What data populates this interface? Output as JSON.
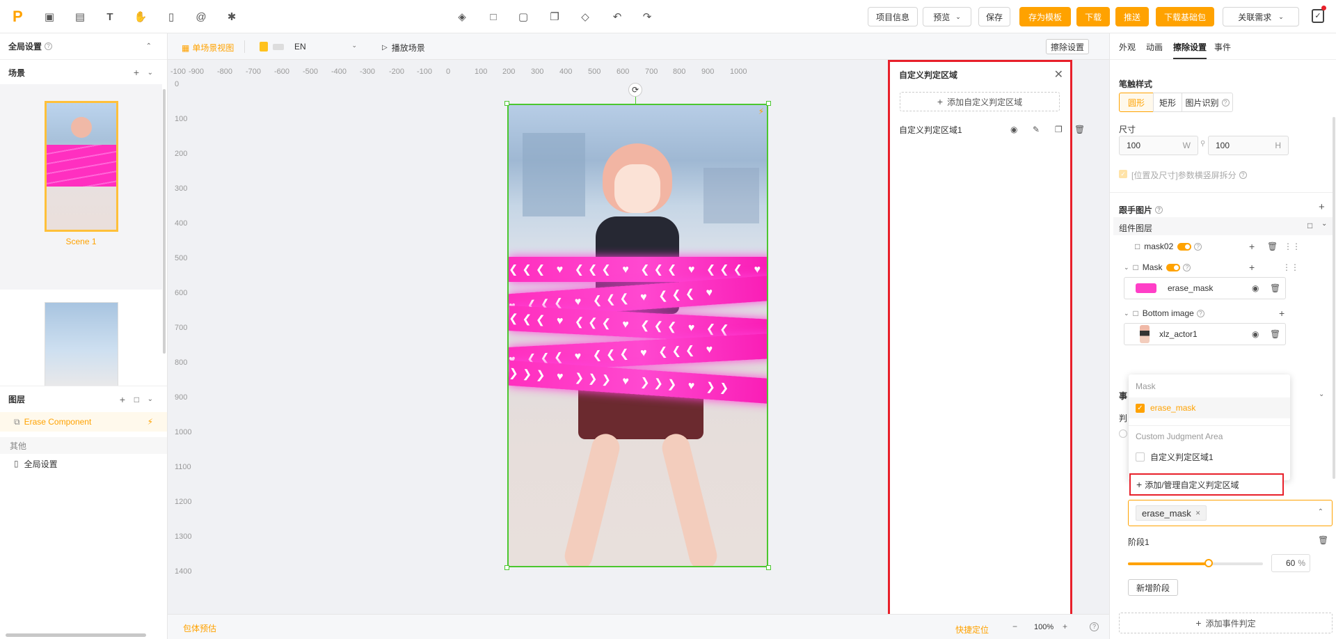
{
  "topbar": {
    "buttons": {
      "project_info": "项目信息",
      "preview": "预览",
      "save": "保存",
      "save_template": "存为模板",
      "download": "下载",
      "push": "推送",
      "download_base": "下载基础包",
      "link_requirement": "关联需求"
    }
  },
  "left": {
    "global_settings": "全局设置",
    "scene_header": "场景",
    "scene1_label": "Scene 1",
    "layers_header": "图层",
    "erase_component": "Erase Component",
    "other": "其他",
    "global_settings_item": "全局设置"
  },
  "canvas": {
    "tab_single_view": "单场景视图",
    "lang": "EN",
    "play_scene": "播放场景",
    "erase_settings_btn": "擦除设置",
    "footer_left": "包体预估",
    "quick_locate": "快捷定位",
    "zoom": "100%",
    "ruler_top": [
      "-100",
      "-900",
      "-800",
      "-700",
      "-600",
      "-500",
      "-400",
      "-300",
      "-200",
      "-100",
      "0",
      "100",
      "200",
      "300",
      "400",
      "500",
      "600",
      "700",
      "800",
      "900",
      "1000"
    ],
    "ruler_left": [
      "0",
      "100",
      "200",
      "300",
      "400",
      "500",
      "600",
      "700",
      "800",
      "900",
      "1000",
      "1100",
      "1200",
      "1300",
      "1400"
    ]
  },
  "custom_panel": {
    "title": "自定义判定区域",
    "add_btn": "添加自定义判定区域",
    "items": [
      "自定义判定区域1"
    ]
  },
  "right": {
    "tabs": [
      "外观",
      "动画",
      "擦除设置",
      "事件"
    ],
    "brush_style": "笔触样式",
    "brush_options": [
      "圆形",
      "矩形",
      "图片识别"
    ],
    "size": "尺寸",
    "width": "100",
    "width_unit": "W",
    "height": "100",
    "height_unit": "H",
    "checkbox_label": "[位置及尺寸]参数横竖屏拆分",
    "follow_image": "跟手图片",
    "component_layer": "组件图层",
    "layers": {
      "mask02": "mask02",
      "mask": "Mask",
      "erase_mask": "erase_mask",
      "bottom_image": "Bottom image",
      "xlz_actor": "xlz_actor1"
    },
    "dropdown": {
      "group1": "Mask",
      "opt1": "erase_mask",
      "group2": "Custom Judgment Area",
      "opt2": "自定义判定区域1",
      "manage": "添加/管理自定义判定区域"
    },
    "selected_tag": "erase_mask",
    "stage": "阶段1",
    "stage_value": "60",
    "stage_unit": "%",
    "stage_fill_fraction": 0.6,
    "add_stage": "新增阶段",
    "add_event": "添加事件判定",
    "hidden_prefix1": "事",
    "hidden_prefix2": "判"
  },
  "colors": {
    "accent": "#ffa200",
    "highlight_red": "#e8202a",
    "selection_green": "#4bc72e"
  }
}
